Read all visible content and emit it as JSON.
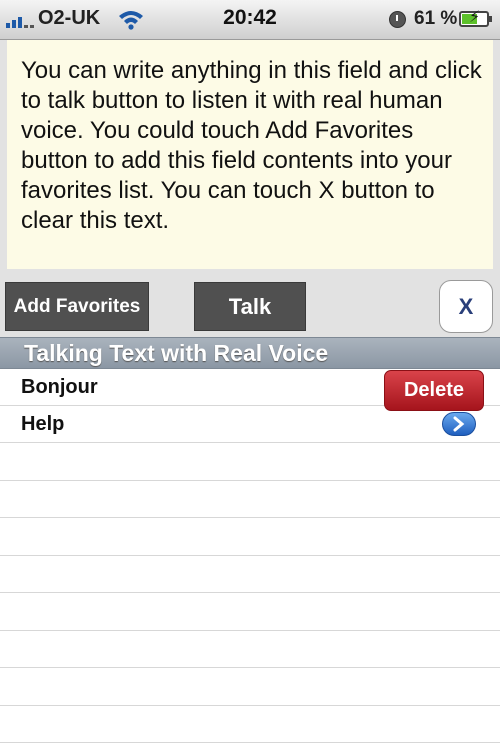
{
  "status_bar": {
    "carrier": "O2-UK",
    "time": "20:42",
    "battery_percent": "61 %",
    "battery_level": 0.61,
    "icons": [
      "signal-icon",
      "wifi-icon",
      "lock-rotation-icon",
      "battery-icon"
    ]
  },
  "text_area": {
    "content": "You can write anything in this field and click to talk button to listen it with real human voice. You could touch Add Favorites button to add this field contents into your favorites list. You can touch X button to clear this text."
  },
  "toolbar": {
    "add_favorites_label": "Add Favorites",
    "talk_label": "Talk",
    "clear_label": "X"
  },
  "section": {
    "title": "Talking Text with Real Voice"
  },
  "list": {
    "items": [
      {
        "label": "Bonjour",
        "action": "Delete"
      },
      {
        "label": "Help",
        "accessory": "disclosure-icon"
      }
    ]
  },
  "colors": {
    "text_area_bg": "#fdfbe6",
    "dark_button": "#505050",
    "delete_red": "#c1252d",
    "header_blue_gray": "#9aa4af",
    "disclosure_blue": "#3a7fd6"
  }
}
